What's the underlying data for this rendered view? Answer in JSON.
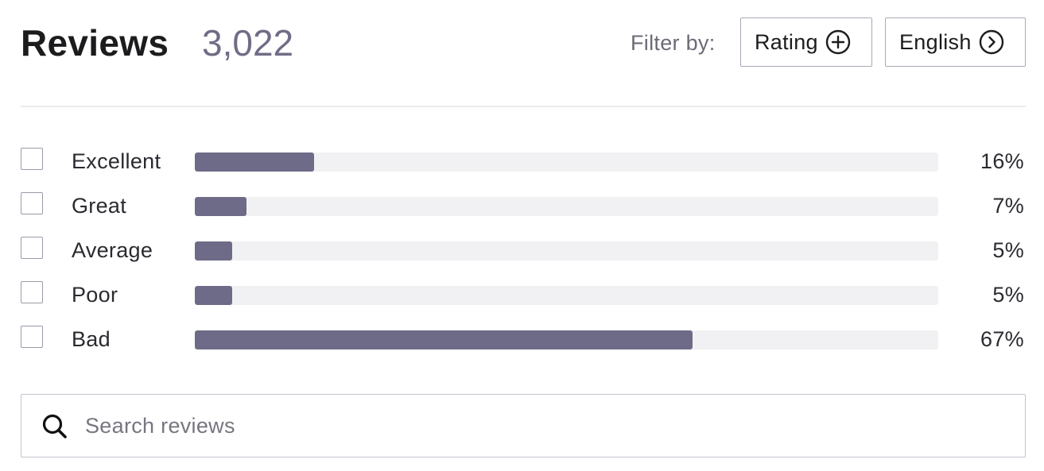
{
  "header": {
    "title": "Reviews",
    "count": "3,022",
    "filter_label": "Filter by:",
    "filters": [
      {
        "label": "Rating",
        "icon": "plus-circle-icon"
      },
      {
        "label": "English",
        "icon": "chevron-right-circle-icon"
      }
    ]
  },
  "ratings": [
    {
      "label": "Excellent",
      "percent_text": "16%",
      "fraction": 0.16
    },
    {
      "label": "Great",
      "percent_text": "7%",
      "fraction": 0.07
    },
    {
      "label": "Average",
      "percent_text": "5%",
      "fraction": 0.05
    },
    {
      "label": "Poor",
      "percent_text": "5%",
      "fraction": 0.05
    },
    {
      "label": "Bad",
      "percent_text": "67%",
      "fraction": 0.67
    }
  ],
  "search": {
    "placeholder": "Search reviews",
    "value": "",
    "icon": "search-icon"
  },
  "colors": {
    "bar_fill": "#6d6b87",
    "bar_track": "#f1f1f3",
    "count_text": "#6f6d86"
  }
}
